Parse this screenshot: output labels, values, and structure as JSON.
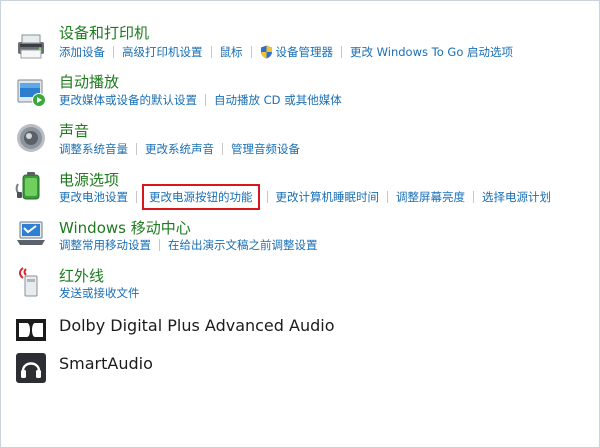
{
  "items": [
    {
      "title": "设备和打印机",
      "icon": "printer-icon",
      "links": [
        "添加设备",
        "高级打印机设置",
        "鼠标",
        "设备管理器",
        "更改 Windows To Go 启动选项"
      ]
    },
    {
      "title": "自动播放",
      "icon": "autoplay-icon",
      "links": [
        "更改媒体或设备的默认设置",
        "自动播放 CD 或其他媒体"
      ]
    },
    {
      "title": "声音",
      "icon": "speaker-icon",
      "links": [
        "调整系统音量",
        "更改系统声音",
        "管理音频设备"
      ]
    },
    {
      "title": "电源选项",
      "icon": "battery-icon",
      "links": [
        "更改电池设置",
        "更改电源按钮的功能",
        "更改计算机睡眠时间",
        "调整屏幕亮度",
        "选择电源计划"
      ]
    },
    {
      "title": "Windows 移动中心",
      "icon": "mobility-center-icon",
      "links": [
        "调整常用移动设置",
        "在给出演示文稿之前调整设置"
      ]
    },
    {
      "title": "红外线",
      "icon": "infrared-icon",
      "links": [
        "发送或接收文件"
      ]
    },
    {
      "title": "Dolby Digital Plus Advanced Audio",
      "icon": "dolby-icon",
      "links": []
    },
    {
      "title": "SmartAudio",
      "icon": "smartaudio-icon",
      "links": []
    }
  ],
  "highlight_color": "#d9171b",
  "link_color": "#1a6fb4",
  "title_color": "#1e7b1e"
}
